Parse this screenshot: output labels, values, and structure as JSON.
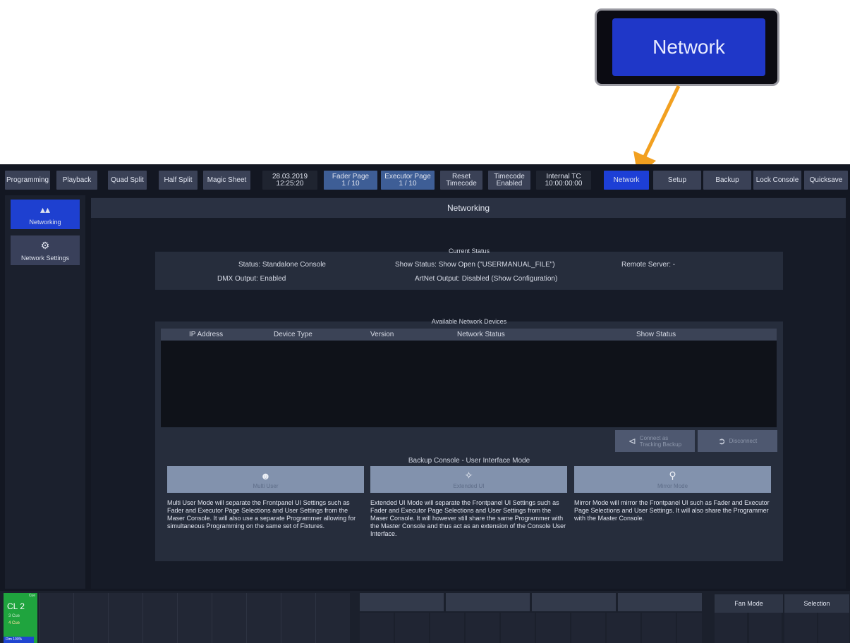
{
  "callout": {
    "label": "Network"
  },
  "topbar": {
    "programming": "Programming",
    "playback": "Playback",
    "quad_split": "Quad Split",
    "half_split": "Half Split",
    "magic_sheet": "Magic Sheet",
    "date": "28.03.2019",
    "time": "12:25:20",
    "fader_page_label": "Fader Page",
    "fader_page_value": "1 / 10",
    "executor_page_label": "Executor Page",
    "executor_page_value": "1 / 10",
    "reset_label": "Reset",
    "reset_sub": "Timecode",
    "timecode_label": "Timecode",
    "timecode_sub": "Enabled",
    "internal_tc_label": "Internal TC",
    "internal_tc_value": "10:00:00:00",
    "network": "Network",
    "setup": "Setup",
    "backup": "Backup",
    "lock_console": "Lock Console",
    "quicksave": "Quicksave"
  },
  "sidebar": {
    "items": [
      {
        "label": "Networking",
        "icon": "network-icon"
      },
      {
        "label": "Network Settings",
        "icon": "gears-icon"
      }
    ]
  },
  "page": {
    "title": "Networking"
  },
  "current_status": {
    "title": "Current Status",
    "status": "Status: Standalone Console",
    "show_status": "Show Status: Show Open (\"USERMANUAL_FILE\")",
    "remote_server": "Remote Server: -",
    "dmx_output": "DMX Output: Enabled",
    "artnet_output": "ArtNet Output: Disabled (Show Configuration)"
  },
  "devices": {
    "title": "Available Network Devices",
    "columns": [
      "IP Address",
      "Device Type",
      "Version",
      "Network Status",
      "Show Status"
    ],
    "rows": []
  },
  "actions": {
    "connect_label_1": "Connect as",
    "connect_label_2": "Tracking Backup",
    "disconnect_label": "Disconnect"
  },
  "backup_mode": {
    "title": "Backup Console - User Interface Mode",
    "modes": [
      {
        "label": "Multi User",
        "icon": "users-icon",
        "description": "Multi User Mode will separate the Frontpanel UI Settings such as Fader and Executor Page Selections and User Settings from the Maser Console. It will also use a separate Programmer allowing for simultaneous Programming on the same set of Fixtures."
      },
      {
        "label": "Extended UI",
        "icon": "extend-icon",
        "description": "Extended UI Mode will separate the Frontpanel UI Settings such as Fader and Executor Page Selections and User Settings from the Maser Console. It will however still share the same Programmer with the Master Console and thus act as an extension of the Console User Interface."
      },
      {
        "label": "Mirror Mode",
        "icon": "mirror-icon",
        "description": "Mirror Mode will mirror the Frontpanel UI such as Fader and Executor Page Selections and User Settings. It will also share the Programmer with the Master Console."
      }
    ]
  },
  "bottom": {
    "cue_list": "CL 2",
    "cue_top": "Cue",
    "cue_prev": "3 Cue",
    "cue_next": "4 Cue",
    "cue_level": "Dim 100%",
    "fan_mode": "Fan Mode",
    "selection": "Selection"
  },
  "colors": {
    "active": "#1d3fd6",
    "cue_green": "#1fa43e",
    "arrow": "#f2a020"
  }
}
